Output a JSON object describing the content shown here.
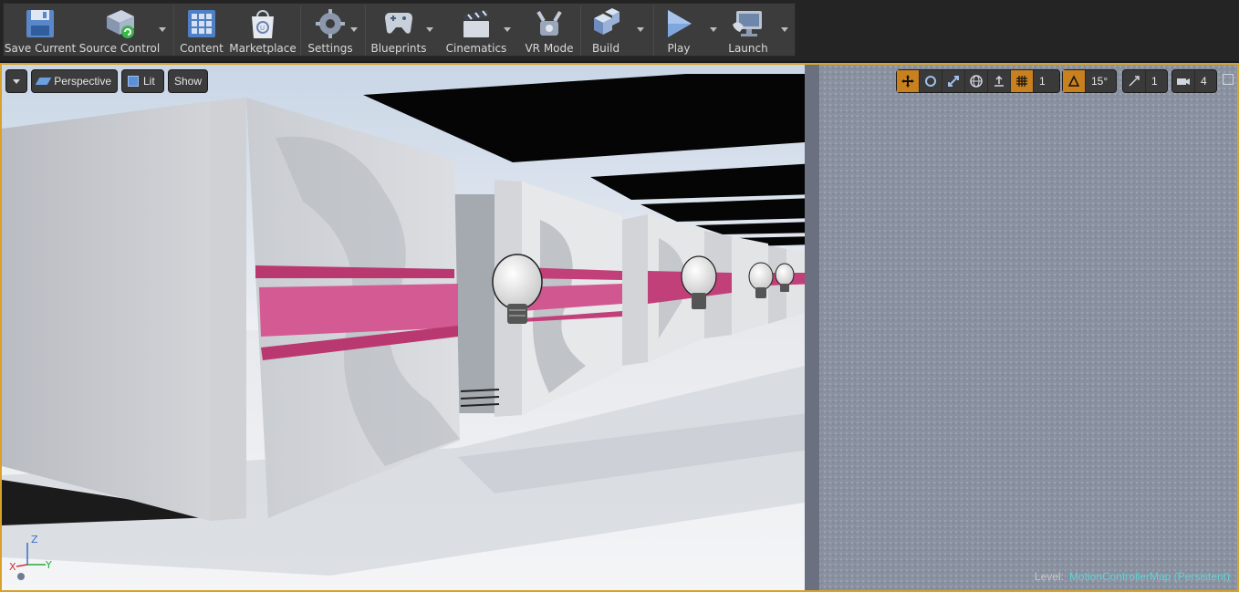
{
  "toolbar": {
    "buttons": [
      {
        "label": "Save Current",
        "icon": "save-icon"
      },
      {
        "label": "Source Control",
        "icon": "source-control-icon"
      },
      {
        "label": "Content",
        "icon": "content-icon"
      },
      {
        "label": "Marketplace",
        "icon": "marketplace-icon"
      },
      {
        "label": "Settings",
        "icon": "settings-icon"
      },
      {
        "label": "Blueprints",
        "icon": "blueprints-icon"
      },
      {
        "label": "Cinematics",
        "icon": "cinematics-icon"
      },
      {
        "label": "VR Mode",
        "icon": "vr-mode-icon"
      },
      {
        "label": "Build",
        "icon": "build-icon"
      },
      {
        "label": "Play",
        "icon": "play-icon"
      },
      {
        "label": "Launch",
        "icon": "launch-icon"
      }
    ]
  },
  "viewport": {
    "perspective_label": "Perspective",
    "lit_label": "Lit",
    "show_label": "Show",
    "grid_snap_value": "1",
    "rotation_snap_value": "15°",
    "scale_snap_value": "1",
    "camera_speed_value": "4",
    "level_prefix": "Level:",
    "level_name": "MotionControllerMap (Persistent)",
    "axis": {
      "z": "Z",
      "x": "X",
      "y": "Y"
    }
  },
  "colors": {
    "accent": "#d8a12a",
    "active_button": "#c9801e",
    "level_name": "#5fd4d4",
    "stripe": "#c2407a"
  }
}
